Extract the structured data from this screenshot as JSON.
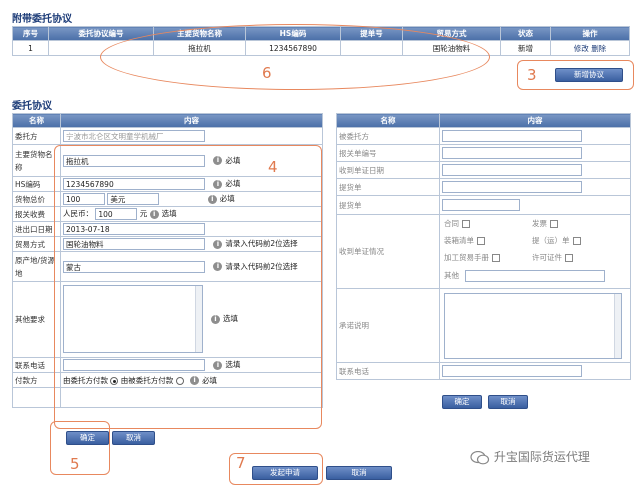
{
  "attached": {
    "title": "附带委托协议",
    "headers": [
      "序号",
      "委托协议编号",
      "主要货物名称",
      "HS编码",
      "提单号",
      "贸易方式",
      "状态",
      "操作"
    ],
    "row": {
      "index": "1",
      "agreement_no": "",
      "goods": "拖拉机",
      "hs": "1234567890",
      "bl": "",
      "trade": "国轮油物料",
      "status": "新增",
      "edit": "修改",
      "delete": "删除"
    },
    "add_button": "新增协议"
  },
  "form": {
    "title": "委托协议",
    "left_headers": [
      "名称",
      "内容"
    ],
    "fields": {
      "client": {
        "label": "委托方",
        "value": "宁波市北仑区文明童学机械厂"
      },
      "goods": {
        "label": "主要货物名称",
        "value": "拖拉机",
        "hint": "必填"
      },
      "hs": {
        "label": "HS编码",
        "value": "1234567890",
        "hint": "必填"
      },
      "total": {
        "label": "货物总价",
        "value": "100",
        "currency": "美元",
        "hint": "必填"
      },
      "customs_fee": {
        "label": "报关收费",
        "prefix": "人民币：",
        "value": "100",
        "unit": "元",
        "hint": "选填"
      },
      "date": {
        "label": "进出口日期",
        "value": "2013-07-18"
      },
      "trade": {
        "label": "贸易方式",
        "value": "国轮油物料",
        "hint": "请录入代码前2位选择"
      },
      "origin": {
        "label": "原产地/货源地",
        "value": "蒙古",
        "hint": "请录入代码前2位选择"
      },
      "other": {
        "label": "其他要求",
        "value": "",
        "hint": "选填"
      },
      "phone": {
        "label": "联系电话",
        "value": "",
        "hint": "选填"
      },
      "payer": {
        "label": "付款方",
        "option1": "由委托方付款",
        "option2": "由被委托方付款",
        "hint": "必填"
      }
    },
    "ok": "确定",
    "cancel": "取消"
  },
  "right": {
    "headers": [
      "名称",
      "内容"
    ],
    "rows": [
      "被委托方",
      "报关单编号",
      "收到单证日期",
      "提货单",
      "提货单"
    ],
    "docs_label": "收到单证情况",
    "docs": [
      "合同",
      "发票",
      "装箱清单",
      "提（运）单",
      "加工贸易手册",
      "许可证件",
      "其他"
    ],
    "commit_label": "承诺说明",
    "phone_label": "联系电话",
    "ok": "确定",
    "cancel": "取消"
  },
  "footer": {
    "submit": "发起申请",
    "cancel": "取消"
  },
  "annotations": [
    "6",
    "3",
    "4",
    "5",
    "7"
  ],
  "watermark": "升宝国际货运代理"
}
